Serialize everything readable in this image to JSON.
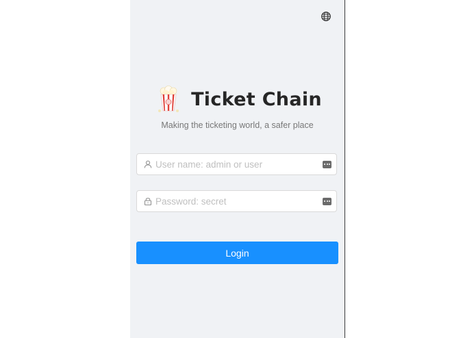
{
  "header": {
    "language_icon": "globe-icon"
  },
  "brand": {
    "logo_icon": "popcorn-icon",
    "title": "Ticket Chain",
    "subtitle": "Making the ticketing world, a safer place"
  },
  "form": {
    "username": {
      "value": "",
      "placeholder": "User name: admin or user",
      "prefix_icon": "user-icon",
      "suffix_icon": "password-manager-icon"
    },
    "password": {
      "value": "",
      "placeholder": "Password: secret",
      "prefix_icon": "lock-icon",
      "suffix_icon": "password-manager-icon"
    },
    "login_label": "Login"
  },
  "colors": {
    "primary": "#1890ff",
    "background": "#f0f2f5"
  }
}
